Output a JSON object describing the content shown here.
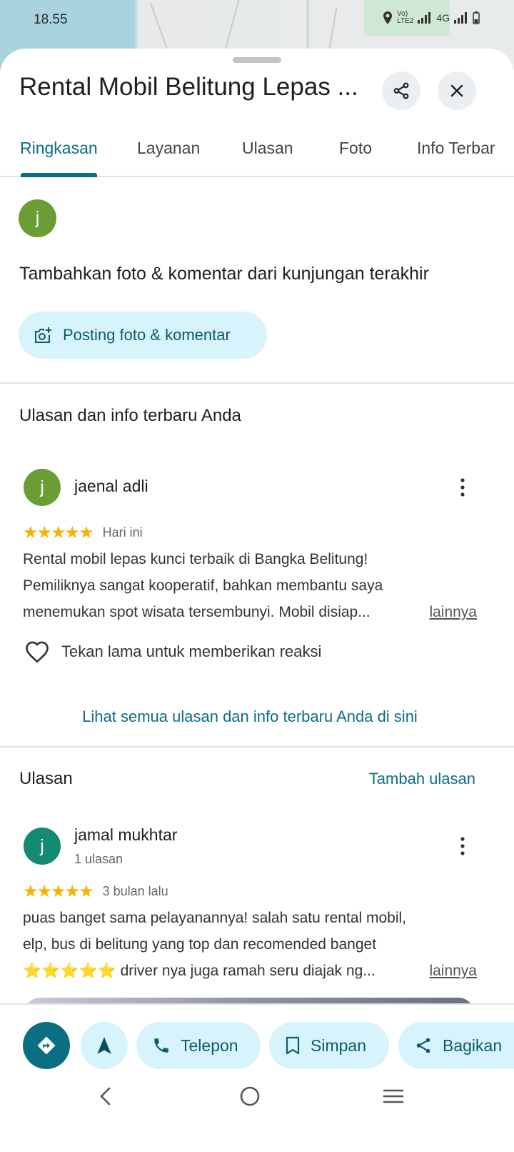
{
  "status": {
    "time": "18.55",
    "network": "4G"
  },
  "place": {
    "title": "Rental Mobil Belitung Lepas ..."
  },
  "tabs": [
    "Ringkasan",
    "Layanan",
    "Ulasan",
    "Foto",
    "Info Terbar"
  ],
  "contribute": {
    "avatar_letter": "j",
    "heading": "Tambahkan foto & komentar dari kunjungan terakhir",
    "post_button": "Posting foto & komentar"
  },
  "your_reviews": {
    "section_title": "Ulasan dan info terbaru Anda",
    "review": {
      "avatar_letter": "j",
      "author": "jaenal adli",
      "rating": 5,
      "stars": "★★★★★",
      "date": "Hari ini",
      "text_lines": [
        "Rental mobil lepas kunci terbaik di Bangka Belitung!",
        "Pemiliknya sangat kooperatif, bahkan membantu saya",
        "menemukan spot wisata tersembunyi. Mobil disiap..."
      ],
      "more": "lainnya",
      "react_hint": "Tekan lama untuk memberikan reaksi"
    },
    "see_all": "Lihat semua ulasan dan info terbaru Anda di sini"
  },
  "reviews": {
    "section_title": "Ulasan",
    "add_review": "Tambah ulasan",
    "review": {
      "avatar_letter": "j",
      "author": "jamal mukhtar",
      "count": "1 ulasan",
      "rating": 5,
      "stars": "★★★★★",
      "date": "3 bulan lalu",
      "text_lines": [
        "puas banget sama pelayanannya! salah satu rental mobil,",
        "elp, bus di belitung yang top dan recomended banget",
        "⭐⭐⭐⭐⭐ driver nya juga ramah seru diajak ng..."
      ],
      "more": "lainnya"
    }
  },
  "actions": {
    "call": "Telepon",
    "save": "Simpan",
    "share": "Bagikan"
  },
  "colors": {
    "accent": "#0b6e82",
    "pill_bg": "#d7f3fb",
    "avatar_green": "#6a9e35",
    "avatar_teal": "#138a72",
    "star": "#f4b400"
  }
}
